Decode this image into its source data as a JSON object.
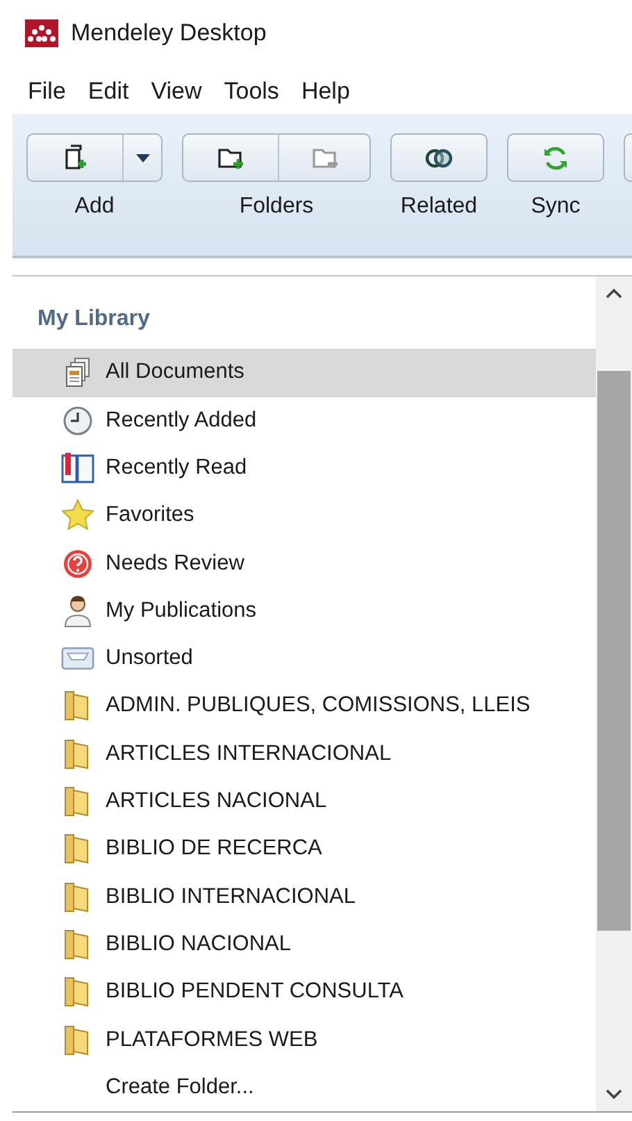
{
  "window": {
    "title": "Mendeley Desktop"
  },
  "menu": [
    "File",
    "Edit",
    "View",
    "Tools",
    "Help"
  ],
  "toolbar": [
    {
      "label": "Add",
      "buttons": [
        {
          "kind": "add-document"
        },
        {
          "kind": "dropdown"
        }
      ]
    },
    {
      "label": "Folders",
      "buttons": [
        {
          "kind": "new-folder"
        },
        {
          "kind": "remove-folder"
        }
      ]
    },
    {
      "label": "Related",
      "buttons": [
        {
          "kind": "related"
        }
      ]
    },
    {
      "label": "Sync",
      "buttons": [
        {
          "kind": "sync"
        }
      ]
    }
  ],
  "library": {
    "title": "My Library",
    "items": [
      {
        "label": "All Documents",
        "kind": "documents",
        "selected": true
      },
      {
        "label": "Recently Added",
        "kind": "clock",
        "selected": false
      },
      {
        "label": "Recently Read",
        "kind": "book",
        "selected": false
      },
      {
        "label": "Favorites",
        "kind": "star",
        "selected": false
      },
      {
        "label": "Needs Review",
        "kind": "question",
        "selected": false
      },
      {
        "label": "My Publications",
        "kind": "person",
        "selected": false
      },
      {
        "label": "Unsorted",
        "kind": "inbox",
        "selected": false
      },
      {
        "label": "ADMIN. PUBLIQUES, COMISSIONS, LLEIS",
        "kind": "folder",
        "selected": false
      },
      {
        "label": "ARTICLES INTERNACIONAL",
        "kind": "folder",
        "selected": false
      },
      {
        "label": "ARTICLES NACIONAL",
        "kind": "folder",
        "selected": false
      },
      {
        "label": "BIBLIO DE RECERCA",
        "kind": "folder",
        "selected": false
      },
      {
        "label": "BIBLIO INTERNACIONAL",
        "kind": "folder",
        "selected": false
      },
      {
        "label": "BIBLIO NACIONAL",
        "kind": "folder",
        "selected": false
      },
      {
        "label": "BIBLIO PENDENT CONSULTA",
        "kind": "folder",
        "selected": false
      },
      {
        "label": "PLATAFORMES WEB",
        "kind": "folder",
        "selected": false
      },
      {
        "label": "Create Folder...",
        "kind": "action",
        "selected": false
      }
    ]
  }
}
